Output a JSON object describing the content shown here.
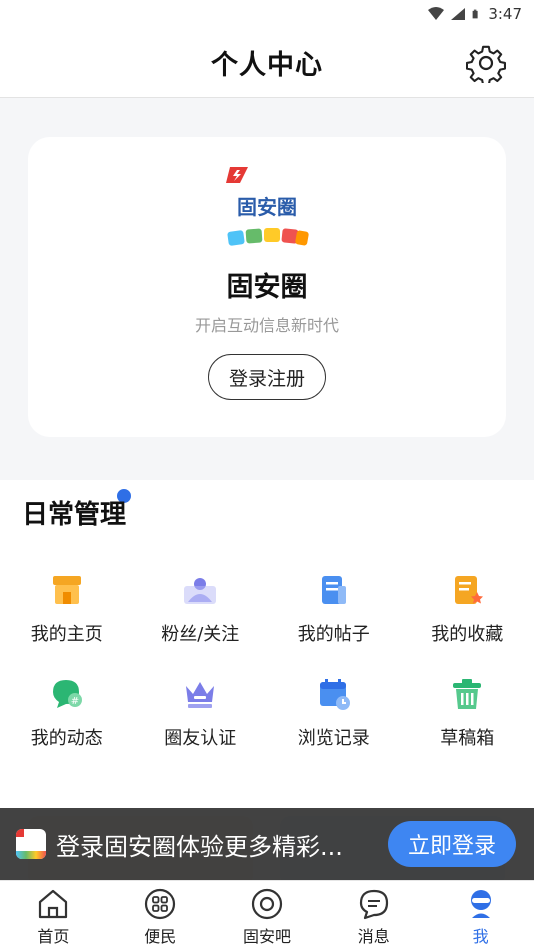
{
  "status_bar": {
    "time": "3:47"
  },
  "header": {
    "title": "个人中心",
    "settings_icon": "gear-icon"
  },
  "profile": {
    "logo_text": "固安圈",
    "app_name": "固安圈",
    "slogan": "开启互动信息新时代",
    "login_label": "登录注册"
  },
  "daily": {
    "title": "日常管理",
    "items": [
      {
        "label": "我的主页",
        "icon": "home-shop-icon",
        "color": "#f5a623"
      },
      {
        "label": "粉丝/关注",
        "icon": "fans-icon",
        "color": "#7b7de8"
      },
      {
        "label": "我的帖子",
        "icon": "posts-icon",
        "color": "#4a8ff0"
      },
      {
        "label": "我的收藏",
        "icon": "favorites-icon",
        "color": "#f5a623"
      },
      {
        "label": "我的动态",
        "icon": "activity-icon",
        "color": "#2bb673"
      },
      {
        "label": "圈友认证",
        "icon": "crown-icon",
        "color": "#7b7de8"
      },
      {
        "label": "浏览记录",
        "icon": "calendar-icon",
        "color": "#4a8ff0"
      },
      {
        "label": "草稿箱",
        "icon": "trash-icon",
        "color": "#2bb673"
      }
    ]
  },
  "banner": {
    "text": "登录固安圈体验更多精彩...",
    "button": "立即登录"
  },
  "tabs": [
    {
      "label": "首页",
      "icon": "home-icon"
    },
    {
      "label": "便民",
      "icon": "grid-icon"
    },
    {
      "label": "固安吧",
      "icon": "target-icon"
    },
    {
      "label": "消息",
      "icon": "message-icon"
    },
    {
      "label": "我",
      "icon": "profile-icon",
      "active": true
    }
  ],
  "colors": {
    "accent": "#2f6fe6",
    "banner_button": "#3e86f2"
  }
}
